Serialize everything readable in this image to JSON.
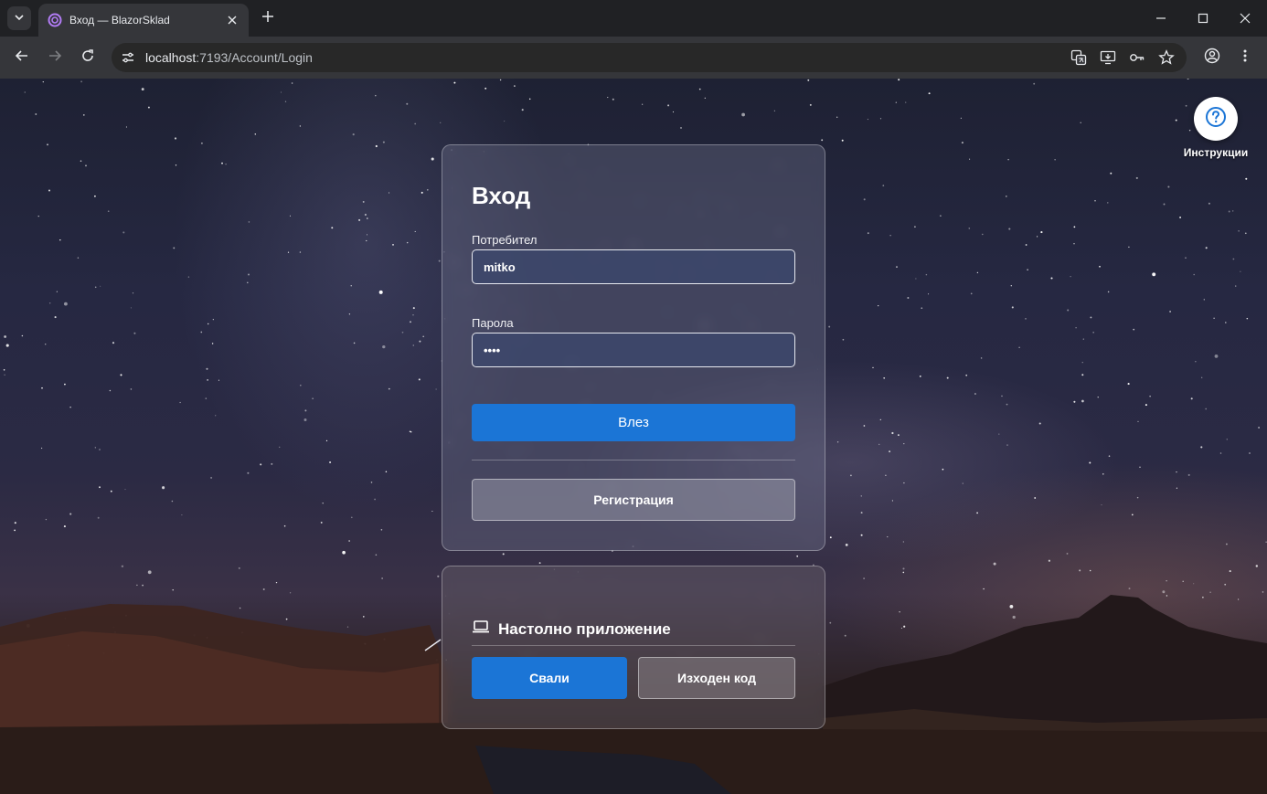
{
  "browser": {
    "tab_title": "Вход — BlazorSklad",
    "url_host": "localhost",
    "url_path": ":7193/Account/Login"
  },
  "login": {
    "title": "Вход",
    "username_label": "Потребител",
    "username_value": "mitko",
    "password_label": "Парола",
    "password_value": "••••",
    "login_button": "Влез",
    "register_button": "Регистрация"
  },
  "desktop": {
    "title": "Настолно приложение",
    "download_button": "Свали",
    "source_button": "Изходен код"
  },
  "help": {
    "label": "Инструкции"
  },
  "colors": {
    "primary": "#1b75d6",
    "tab_bg": "#35363a",
    "chrome_bg": "#202124"
  }
}
